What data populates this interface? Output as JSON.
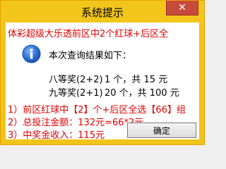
{
  "window": {
    "title": "系统提示",
    "close_glyph": "✕"
  },
  "message": {
    "headline": "体彩超级大乐透前区中2个红球+后区全",
    "query_result": "本次查询结果如下：",
    "prizes": [
      {
        "label": "八等奖(2+2)",
        "count": "1 个，共 15 元"
      },
      {
        "label": "九等奖(2+1)",
        "count": "20 个，共 100 元"
      }
    ],
    "notes": [
      "1）前区红球中【2】个+后区全选【66】组",
      "2）总投注金额：132元=66*2元",
      "3）中奖金收入：115元"
    ]
  },
  "buttons": {
    "ok_label": "确定"
  },
  "colors": {
    "title_bar": "#f3c61c",
    "close_button": "#c74b3b",
    "highlight_text": "#e00000"
  }
}
